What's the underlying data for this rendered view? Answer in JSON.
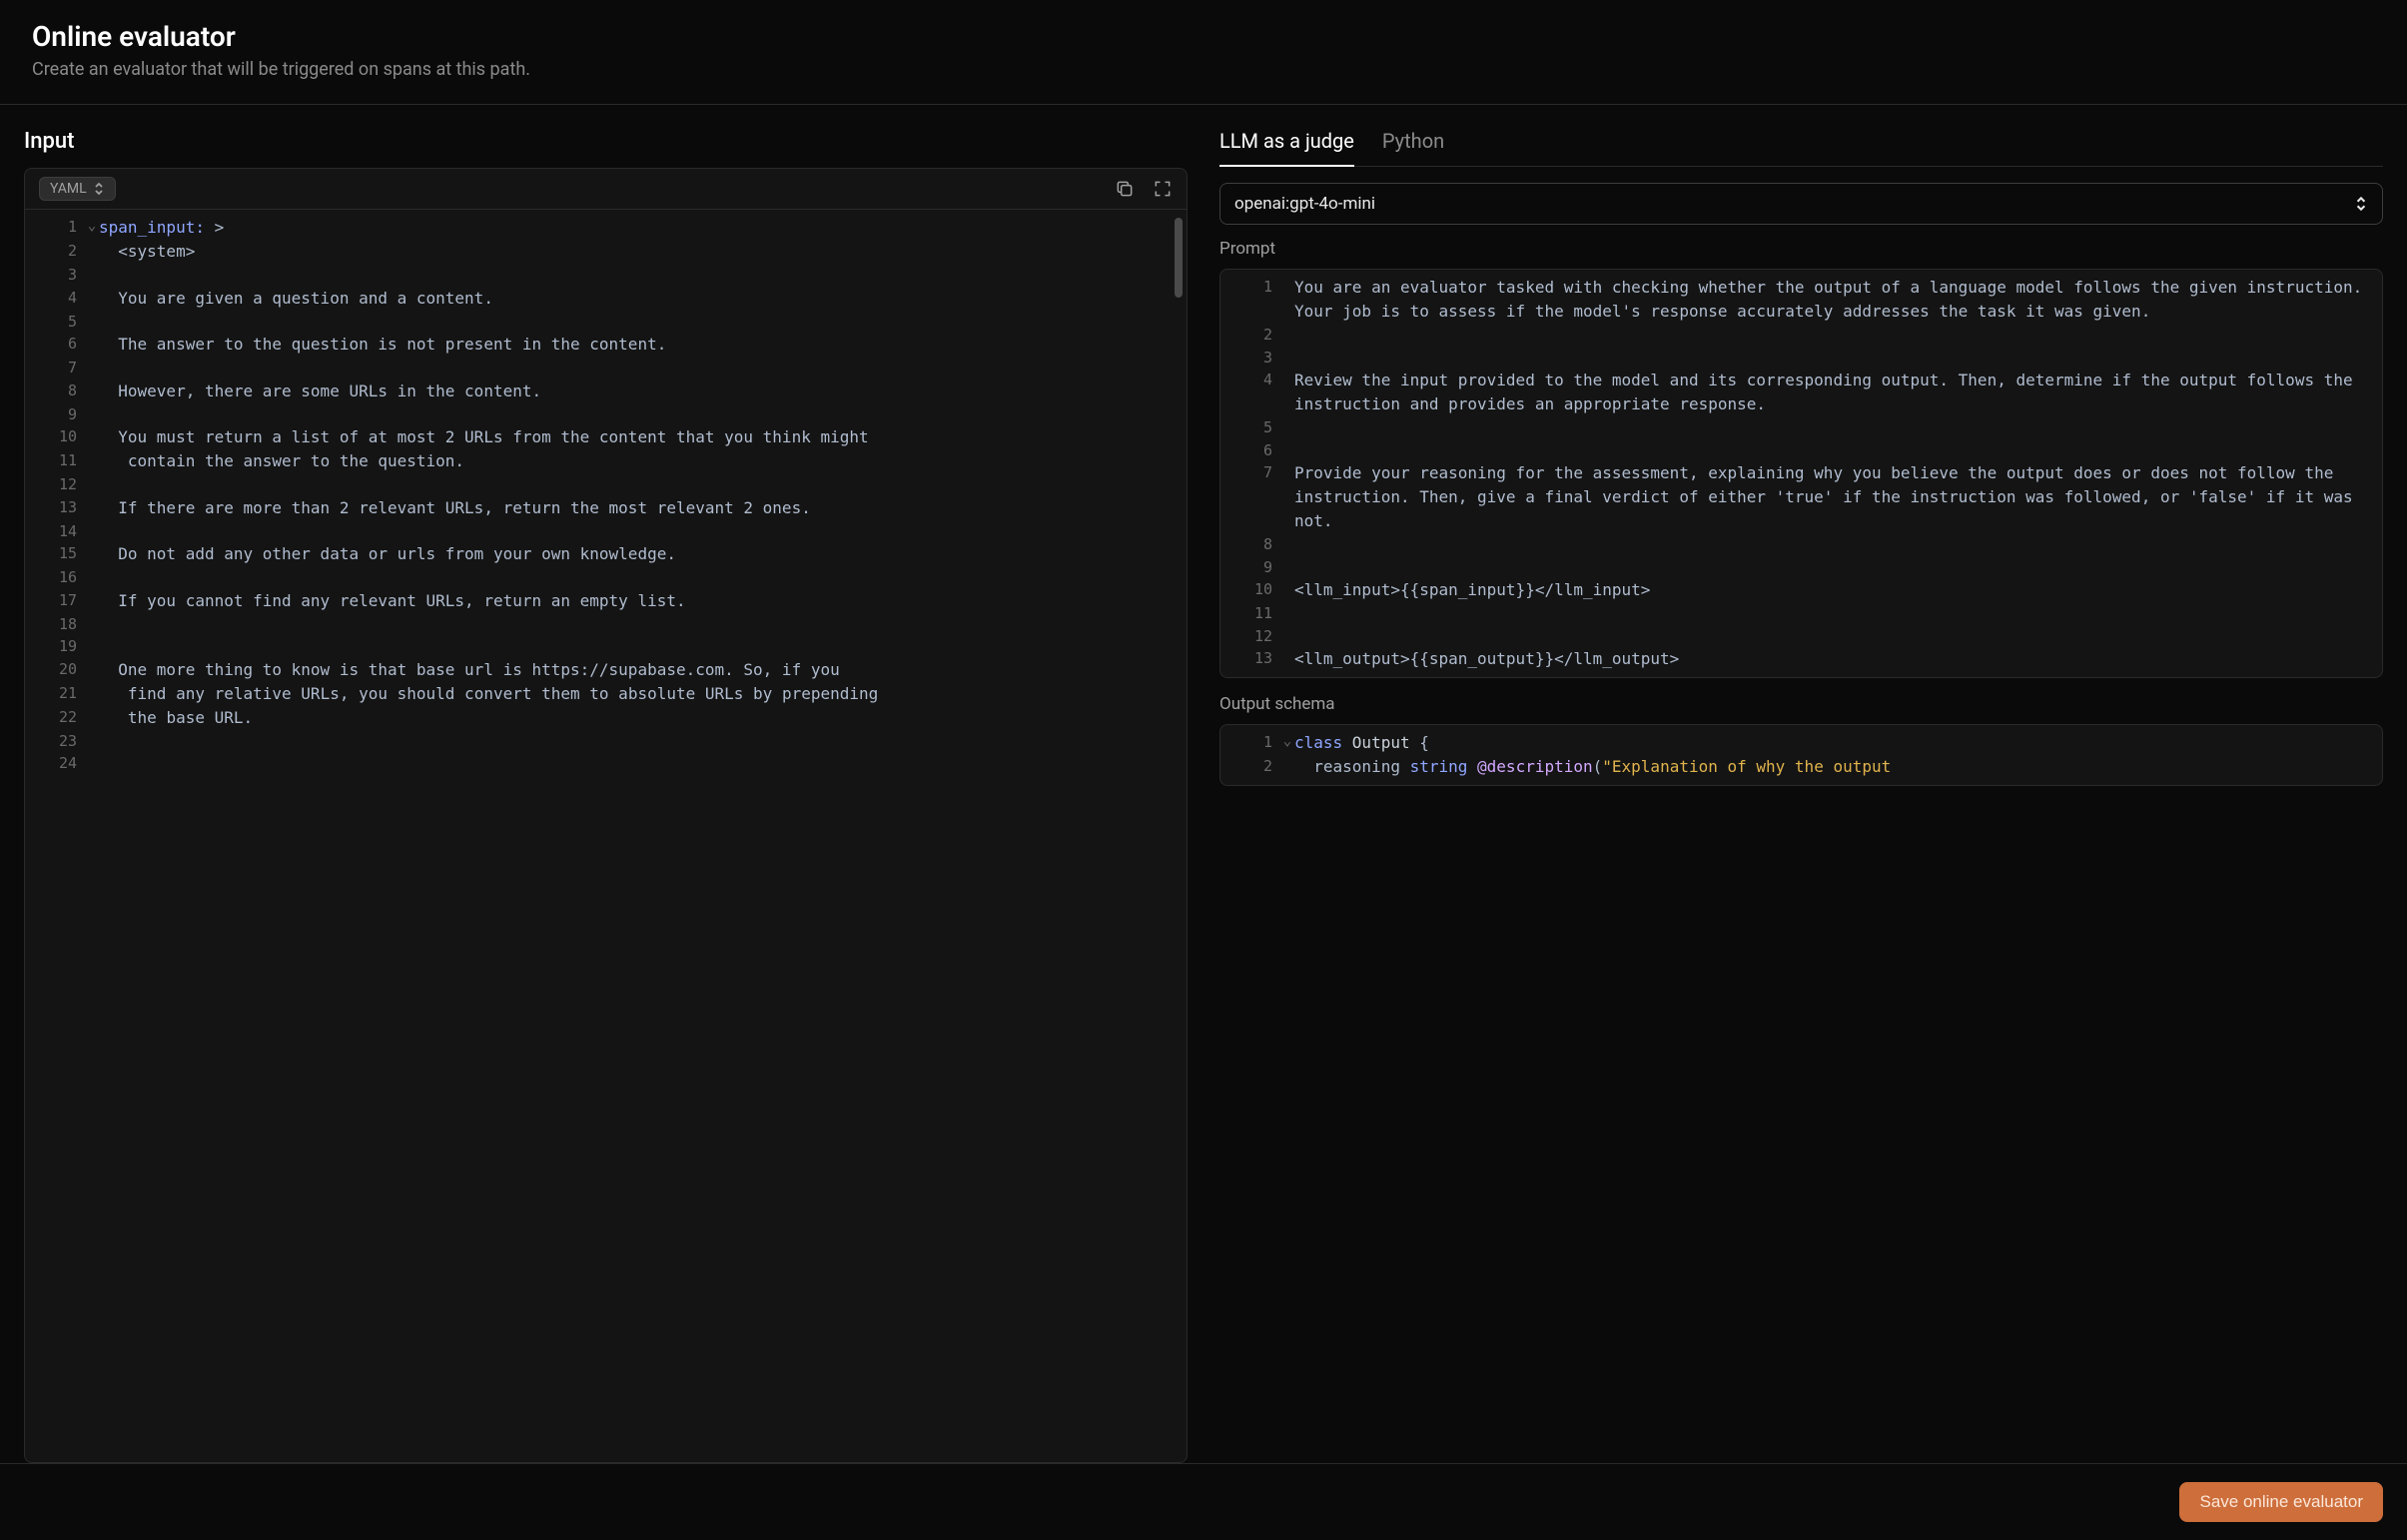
{
  "header": {
    "title": "Online evaluator",
    "subtitle": "Create an evaluator that will be triggered on spans at this path."
  },
  "input": {
    "heading": "Input",
    "lang_badge": "YAML",
    "lines": [
      {
        "n": 1,
        "fold": "v",
        "segments": [
          {
            "t": "span_input:",
            "c": "k-key"
          },
          {
            "t": " "
          },
          {
            "t": ">",
            "c": "k-op"
          }
        ]
      },
      {
        "n": 2,
        "segments": [
          {
            "t": "  <system>"
          }
        ]
      },
      {
        "n": 3,
        "segments": [
          {
            "t": ""
          }
        ]
      },
      {
        "n": 4,
        "segments": [
          {
            "t": "  You are given a question and a content."
          }
        ]
      },
      {
        "n": 5,
        "segments": [
          {
            "t": ""
          }
        ]
      },
      {
        "n": 6,
        "segments": [
          {
            "t": "  The answer to the question is not present in the content."
          }
        ]
      },
      {
        "n": 7,
        "segments": [
          {
            "t": ""
          }
        ]
      },
      {
        "n": 8,
        "segments": [
          {
            "t": "  However, there are some URLs in the content."
          }
        ]
      },
      {
        "n": 9,
        "segments": [
          {
            "t": ""
          }
        ]
      },
      {
        "n": 10,
        "segments": [
          {
            "t": "  You must return a list of at most 2 URLs from the content that you think might"
          }
        ]
      },
      {
        "n": 11,
        "segments": [
          {
            "t": "   contain the answer to the question."
          }
        ]
      },
      {
        "n": 12,
        "segments": [
          {
            "t": ""
          }
        ]
      },
      {
        "n": 13,
        "segments": [
          {
            "t": "  If there are more than 2 relevant URLs, return the most relevant 2 ones."
          }
        ]
      },
      {
        "n": 14,
        "segments": [
          {
            "t": ""
          }
        ]
      },
      {
        "n": 15,
        "segments": [
          {
            "t": "  Do not add any other data or urls from your own knowledge."
          }
        ]
      },
      {
        "n": 16,
        "segments": [
          {
            "t": ""
          }
        ]
      },
      {
        "n": 17,
        "segments": [
          {
            "t": "  If you cannot find any relevant URLs, return an empty list."
          }
        ]
      },
      {
        "n": 18,
        "segments": [
          {
            "t": ""
          }
        ]
      },
      {
        "n": 19,
        "segments": [
          {
            "t": ""
          }
        ]
      },
      {
        "n": 20,
        "segments": [
          {
            "t": "  One more thing to know is that base url is https://supabase.com. So, if you"
          }
        ]
      },
      {
        "n": 21,
        "segments": [
          {
            "t": "   find any relative URLs, you should convert them to absolute URLs by prepending"
          }
        ]
      },
      {
        "n": 22,
        "segments": [
          {
            "t": "   the base URL."
          }
        ]
      },
      {
        "n": 23,
        "segments": [
          {
            "t": ""
          }
        ]
      },
      {
        "n": 24,
        "segments": [
          {
            "t": ""
          }
        ]
      }
    ]
  },
  "judge": {
    "tabs": {
      "llm": "LLM as a judge",
      "python": "Python"
    },
    "model": "openai:gpt-4o-mini",
    "prompt_label": "Prompt",
    "prompt_lines": [
      {
        "n": 1,
        "segments": [
          {
            "t": "You are an evaluator tasked with checking whether the output of a language model follows the given instruction. Your job is to assess if the model's response accurately addresses the task it was given."
          }
        ]
      },
      {
        "n": 2,
        "segments": [
          {
            "t": ""
          }
        ]
      },
      {
        "n": 3,
        "segments": [
          {
            "t": ""
          }
        ]
      },
      {
        "n": 4,
        "segments": [
          {
            "t": "Review the input provided to the model and its corresponding output. Then, determine if the output follows the instruction and provides an appropriate response."
          }
        ]
      },
      {
        "n": 5,
        "segments": [
          {
            "t": ""
          }
        ]
      },
      {
        "n": 6,
        "segments": [
          {
            "t": ""
          }
        ]
      },
      {
        "n": 7,
        "segments": [
          {
            "t": "Provide your reasoning for the assessment, explaining why you believe the output does or does not follow the instruction. Then, give a final verdict of either 'true' if the instruction was followed, or 'false' if it was not."
          }
        ]
      },
      {
        "n": 8,
        "segments": [
          {
            "t": ""
          }
        ]
      },
      {
        "n": 9,
        "segments": [
          {
            "t": ""
          }
        ]
      },
      {
        "n": 10,
        "segments": [
          {
            "t": "<llm_input>{{span_input}}</llm_input>"
          }
        ]
      },
      {
        "n": 11,
        "segments": [
          {
            "t": ""
          }
        ]
      },
      {
        "n": 12,
        "segments": [
          {
            "t": ""
          }
        ]
      },
      {
        "n": 13,
        "segments": [
          {
            "t": "<llm_output>{{span_output}}</llm_output>"
          }
        ]
      }
    ],
    "schema_label": "Output schema",
    "schema_lines": [
      {
        "n": 1,
        "fold": "v",
        "segments": [
          {
            "t": "class ",
            "c": "k-kw"
          },
          {
            "t": "Output",
            "c": "k-class"
          },
          {
            "t": " {"
          }
        ]
      },
      {
        "n": 2,
        "segments": [
          {
            "t": "  reasoning "
          },
          {
            "t": "string",
            "c": "k-kw"
          },
          {
            "t": " "
          },
          {
            "t": "@description",
            "c": "k-func"
          },
          {
            "t": "("
          },
          {
            "t": "\"Explanation of why the output ",
            "c": "k-str"
          }
        ]
      }
    ]
  },
  "footer": {
    "save": "Save online evaluator"
  }
}
